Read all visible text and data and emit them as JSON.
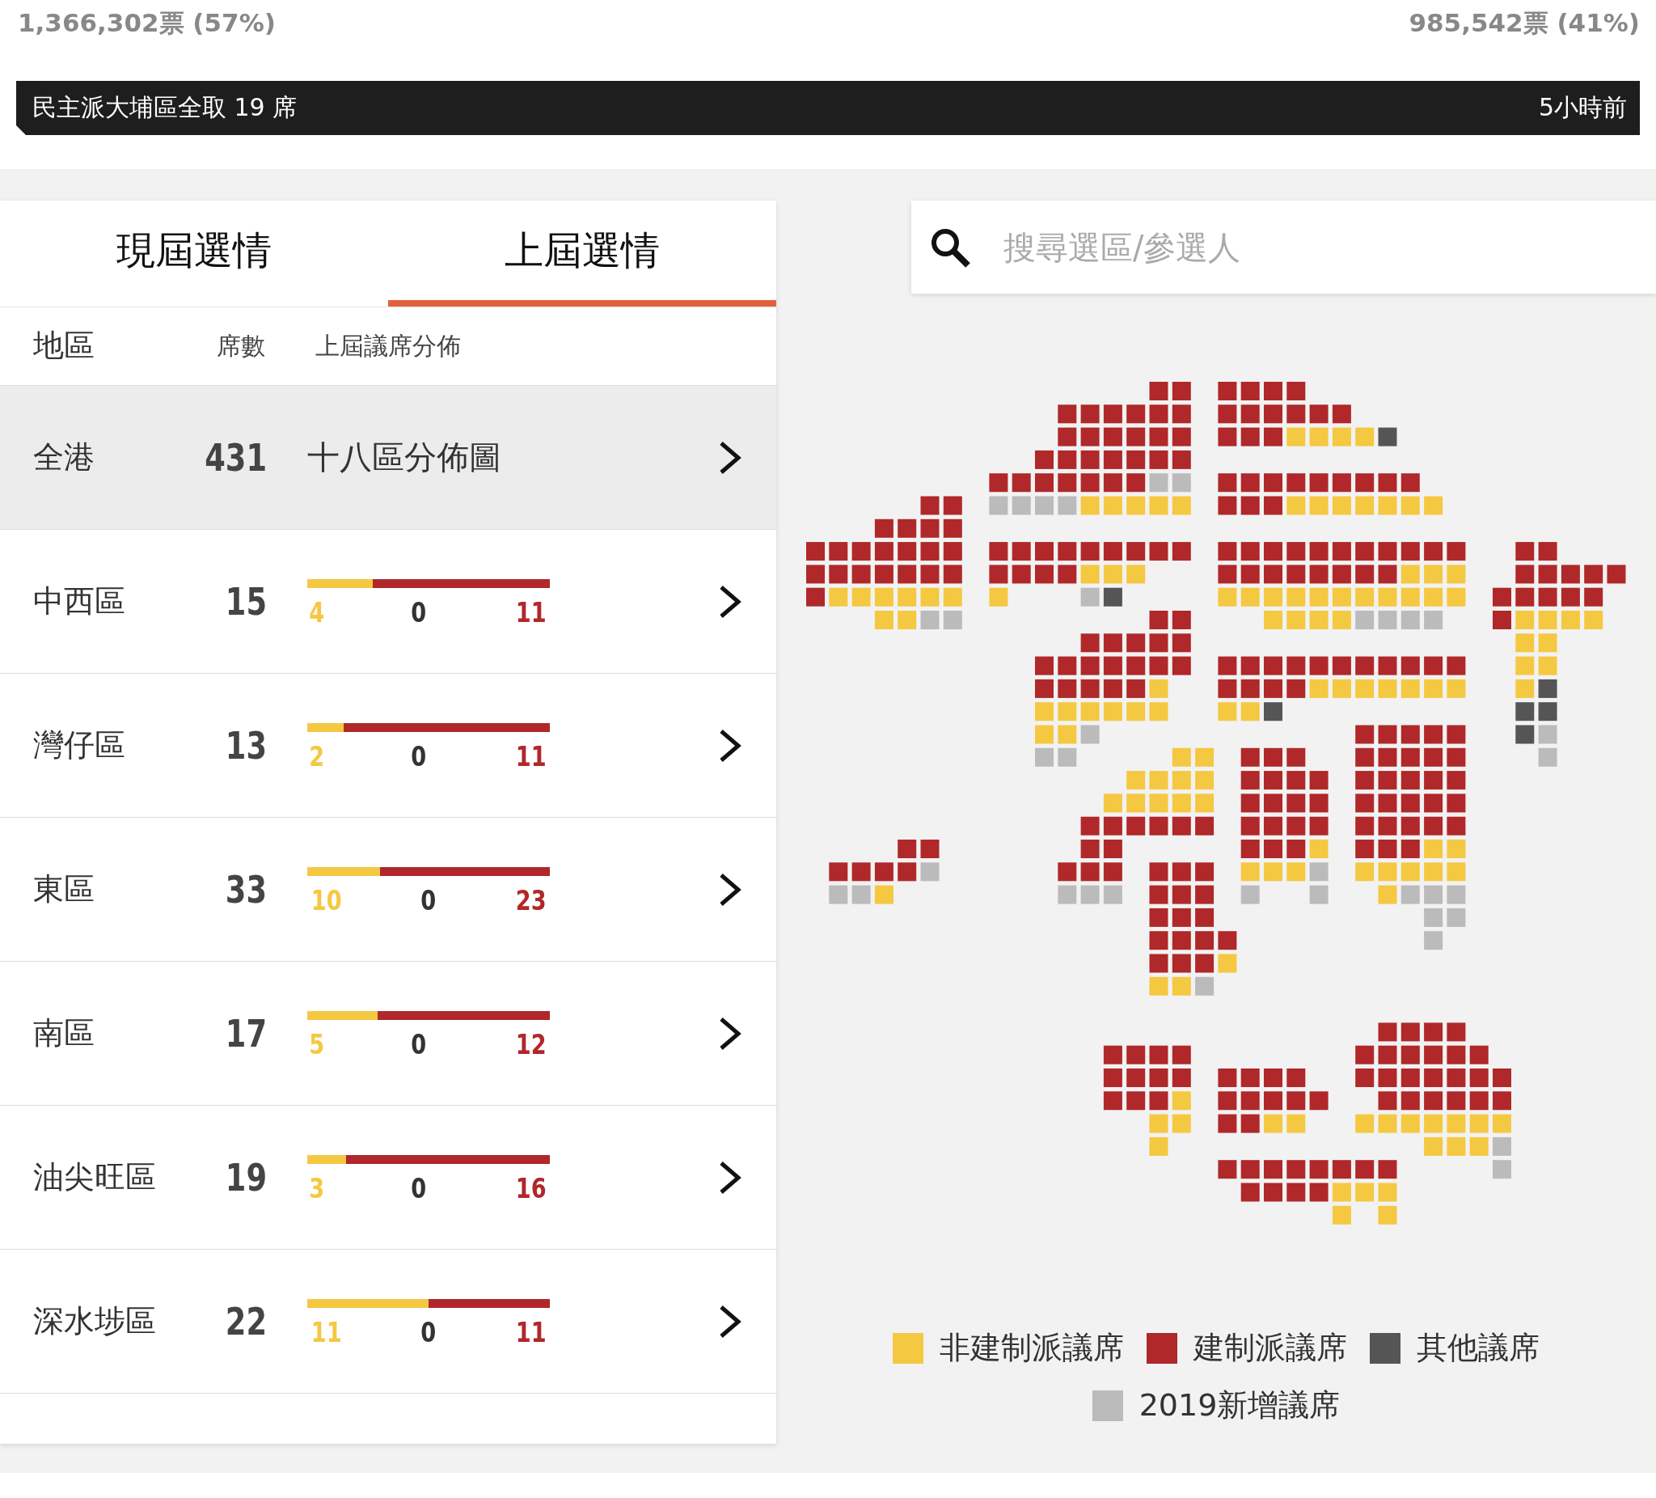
{
  "votes": {
    "left": "1,366,302票 (57%)",
    "right": "985,542票 (41%)"
  },
  "banner": {
    "headline": "民主派大埔區全取 19 席",
    "time": "5小時前"
  },
  "tabs": [
    {
      "label": "現屆選情",
      "selected": false
    },
    {
      "label": "上屆選情",
      "selected": true
    }
  ],
  "table": {
    "columns": [
      "地區",
      "席數",
      "上屆議席分佈"
    ],
    "rows": [
      {
        "kind": "summary",
        "region": "全港",
        "seats": "431",
        "link": "十八區分佈圖",
        "selected": true
      },
      {
        "kind": "bar",
        "region": "中西區",
        "seats": "15",
        "level": 0.27,
        "pro_democracy": "4",
        "others": "0",
        "pro_establishment": "11",
        "selected": false
      },
      {
        "kind": "bar",
        "region": "灣仔區",
        "seats": "13",
        "level": 0.15,
        "pro_democracy": "2",
        "others": "0",
        "pro_establishment": "11",
        "selected": false
      },
      {
        "kind": "bar",
        "region": "東區",
        "seats": "33",
        "level": 0.3,
        "pro_democracy": "10",
        "others": "0",
        "pro_establishment": "23",
        "selected": false
      },
      {
        "kind": "bar",
        "region": "南區",
        "seats": "17",
        "level": 0.29,
        "pro_democracy": "5",
        "others": "0",
        "pro_establishment": "12",
        "selected": false
      },
      {
        "kind": "bar",
        "region": "油尖旺區",
        "seats": "19",
        "level": 0.16,
        "pro_democracy": "3",
        "others": "0",
        "pro_establishment": "16",
        "selected": false
      },
      {
        "kind": "bar",
        "region": "深水埗區",
        "seats": "22",
        "level": 0.5,
        "pro_democracy": "11",
        "others": "0",
        "pro_establishment": "11",
        "selected": false
      }
    ]
  },
  "search": {
    "placeholder": "搜尋選區/參選人"
  },
  "legend": [
    {
      "label": "非建制派議席",
      "color": "#f5c842"
    },
    {
      "label": "建制派議席",
      "color": "#b0282a"
    },
    {
      "label": "其他議席",
      "color": "#555555"
    },
    {
      "label": "2019新增議席",
      "color": "#bbbbbb"
    }
  ]
}
